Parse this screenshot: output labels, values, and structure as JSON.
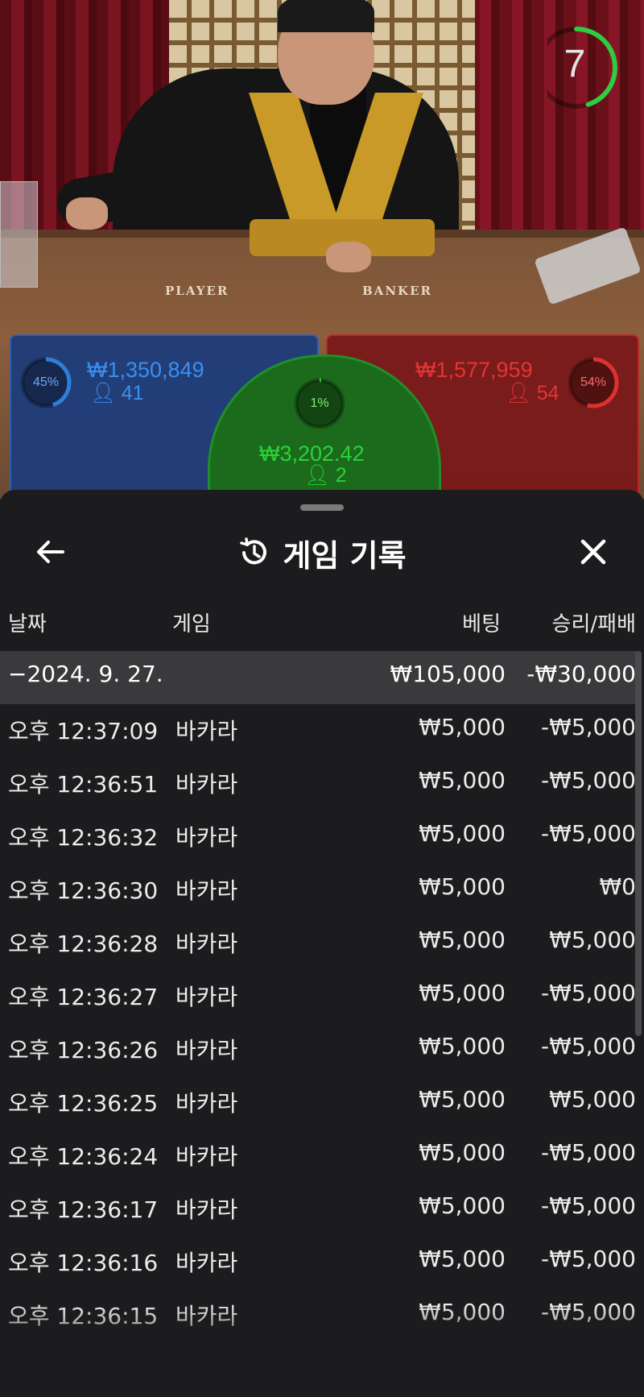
{
  "video": {
    "table_labels": {
      "player": "PLAYER",
      "banker": "BANKER"
    },
    "timer": {
      "value": "7",
      "fraction_remaining": 0.45,
      "color": "#2ecc40"
    }
  },
  "bets": {
    "player": {
      "percent": "45%",
      "amount": "₩1,350,849",
      "count": "41",
      "color": "#2f7fd9"
    },
    "banker": {
      "percent": "54%",
      "amount": "₩1,577,959",
      "count": "54",
      "color": "#e03030"
    },
    "tie": {
      "percent": "1%",
      "amount": "₩3,202.42",
      "count": "2",
      "color": "#2ad23a"
    }
  },
  "history": {
    "title": "게임 기록",
    "icons": {
      "back": "arrow-left-icon",
      "history": "history-icon",
      "close": "close-icon"
    },
    "columns": {
      "date": "날짜",
      "game": "게임",
      "bet": "베팅",
      "result": "승리/패배"
    },
    "date_group": {
      "date": "−2024. 9. 27.",
      "total_bet": "₩105,000",
      "total_result": "-₩30,000"
    },
    "rows": [
      {
        "time": "오후 12:37:09",
        "game": "바카라",
        "bet": "₩5,000",
        "result": "-₩5,000"
      },
      {
        "time": "오후 12:36:51",
        "game": "바카라",
        "bet": "₩5,000",
        "result": "-₩5,000"
      },
      {
        "time": "오후 12:36:32",
        "game": "바카라",
        "bet": "₩5,000",
        "result": "-₩5,000"
      },
      {
        "time": "오후 12:36:30",
        "game": "바카라",
        "bet": "₩5,000",
        "result": "₩0"
      },
      {
        "time": "오후 12:36:28",
        "game": "바카라",
        "bet": "₩5,000",
        "result": "₩5,000"
      },
      {
        "time": "오후 12:36:27",
        "game": "바카라",
        "bet": "₩5,000",
        "result": "-₩5,000"
      },
      {
        "time": "오후 12:36:26",
        "game": "바카라",
        "bet": "₩5,000",
        "result": "-₩5,000"
      },
      {
        "time": "오후 12:36:25",
        "game": "바카라",
        "bet": "₩5,000",
        "result": "₩5,000"
      },
      {
        "time": "오후 12:36:24",
        "game": "바카라",
        "bet": "₩5,000",
        "result": "-₩5,000"
      },
      {
        "time": "오후 12:36:17",
        "game": "바카라",
        "bet": "₩5,000",
        "result": "-₩5,000"
      },
      {
        "time": "오후 12:36:16",
        "game": "바카라",
        "bet": "₩5,000",
        "result": "-₩5,000"
      },
      {
        "time": "오후 12:36:15",
        "game": "바카라",
        "bet": "₩5,000",
        "result": "-₩5,000"
      }
    ]
  }
}
